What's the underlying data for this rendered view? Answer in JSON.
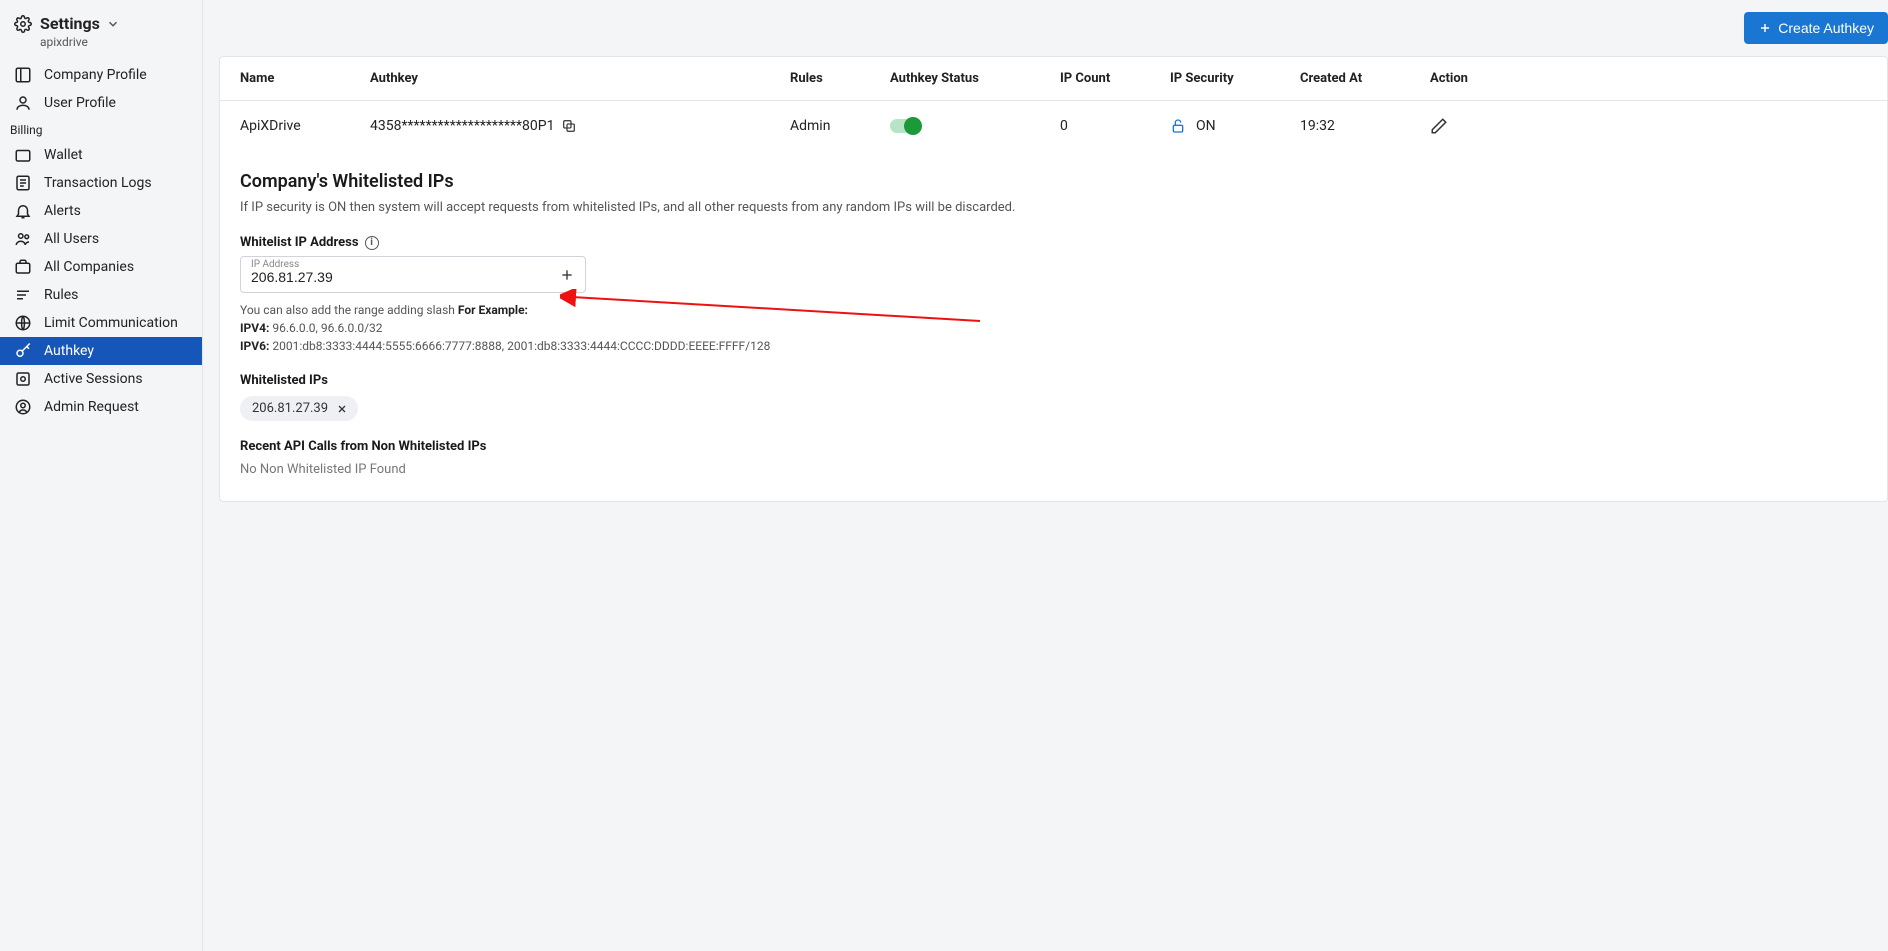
{
  "sidebar": {
    "title": "Settings",
    "subtitle": "apixdrive",
    "items_top": [
      {
        "label": "Company Profile"
      },
      {
        "label": "User Profile"
      }
    ],
    "billing_label": "Billing",
    "items_billing": [
      {
        "label": "Wallet"
      },
      {
        "label": "Transaction Logs"
      },
      {
        "label": "Alerts"
      },
      {
        "label": "All Users"
      },
      {
        "label": "All Companies"
      },
      {
        "label": "Rules"
      },
      {
        "label": "Limit Communication"
      },
      {
        "label": "Authkey"
      },
      {
        "label": "Active Sessions"
      },
      {
        "label": "Admin Request"
      }
    ]
  },
  "topbar": {
    "create_label": "Create Authkey"
  },
  "table": {
    "headers": {
      "name": "Name",
      "authkey": "Authkey",
      "rules": "Rules",
      "status": "Authkey Status",
      "ipcount": "IP Count",
      "ipsec": "IP Security",
      "created": "Created At",
      "action": "Action"
    },
    "row": {
      "name": "ApiXDrive",
      "authkey": "4358********************80P1",
      "rules": "Admin",
      "ipcount": "0",
      "ipsec": "ON",
      "created": "19:32"
    }
  },
  "whitelist": {
    "title": "Company's Whitelisted IPs",
    "desc": "If IP security is ON then system will accept requests from whitelisted IPs, and all other requests from any random IPs will be discarded.",
    "field_label": "Whitelist IP Address",
    "float_label": "IP Address",
    "ip_value": "206.81.27.39",
    "helper_prefix": "You can also add the range adding slash ",
    "helper_forexample": "For Example:",
    "helper_ipv4_label": "IPV4:",
    "helper_ipv4": " 96.6.0.0, 96.6.0.0/32",
    "helper_ipv6_label": "IPV6:",
    "helper_ipv6": " 2001:db8:3333:4444:5555:6666:7777:8888, 2001:db8:3333:4444:CCCC:DDDD:EEEE:FFFF/128",
    "listed_title": "Whitelisted IPs",
    "listed_ip": "206.81.27.39",
    "recent_title": "Recent API Calls from Non Whitelisted IPs",
    "recent_none": "No Non Whitelisted IP Found"
  }
}
